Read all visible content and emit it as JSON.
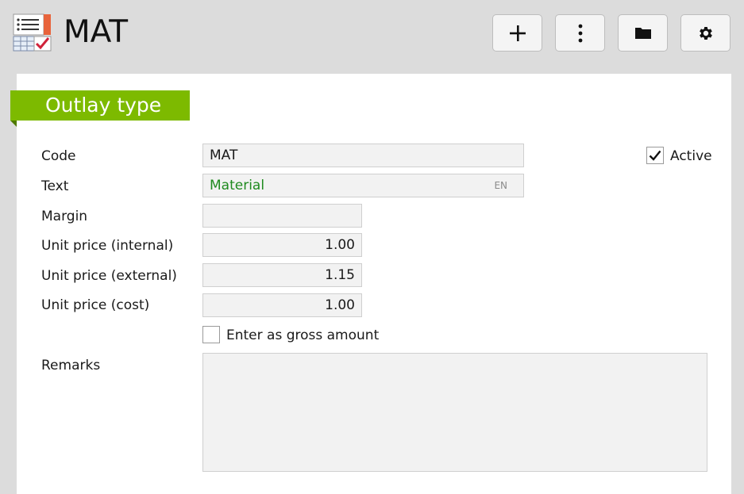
{
  "header": {
    "title": "MAT",
    "app_icon": "list-checklist-icon",
    "toolbar": [
      {
        "name": "add-button",
        "icon": "plus-icon"
      },
      {
        "name": "more-button",
        "icon": "more-vertical-icon"
      },
      {
        "name": "folder-button",
        "icon": "folder-icon"
      },
      {
        "name": "settings-button",
        "icon": "gear-icon"
      }
    ]
  },
  "section": {
    "title": "Outlay type"
  },
  "form": {
    "code_label": "Code",
    "code_value": "MAT",
    "text_label": "Text",
    "text_value": "Material",
    "text_lang": "EN",
    "margin_label": "Margin",
    "margin_value": "",
    "unit_internal_label": "Unit price (internal)",
    "unit_internal_value": "1.00",
    "unit_external_label": "Unit price (external)",
    "unit_external_value": "1.15",
    "unit_cost_label": "Unit price (cost)",
    "unit_cost_value": "1.00",
    "gross_label": "Enter as gross amount",
    "gross_checked": false,
    "active_label": "Active",
    "active_checked": true,
    "remarks_label": "Remarks",
    "remarks_value": ""
  },
  "colors": {
    "accent_green": "#7dba00",
    "text_green": "#1f8a1f",
    "icon_orange": "#e8643c",
    "icon_red": "#d0223a"
  }
}
